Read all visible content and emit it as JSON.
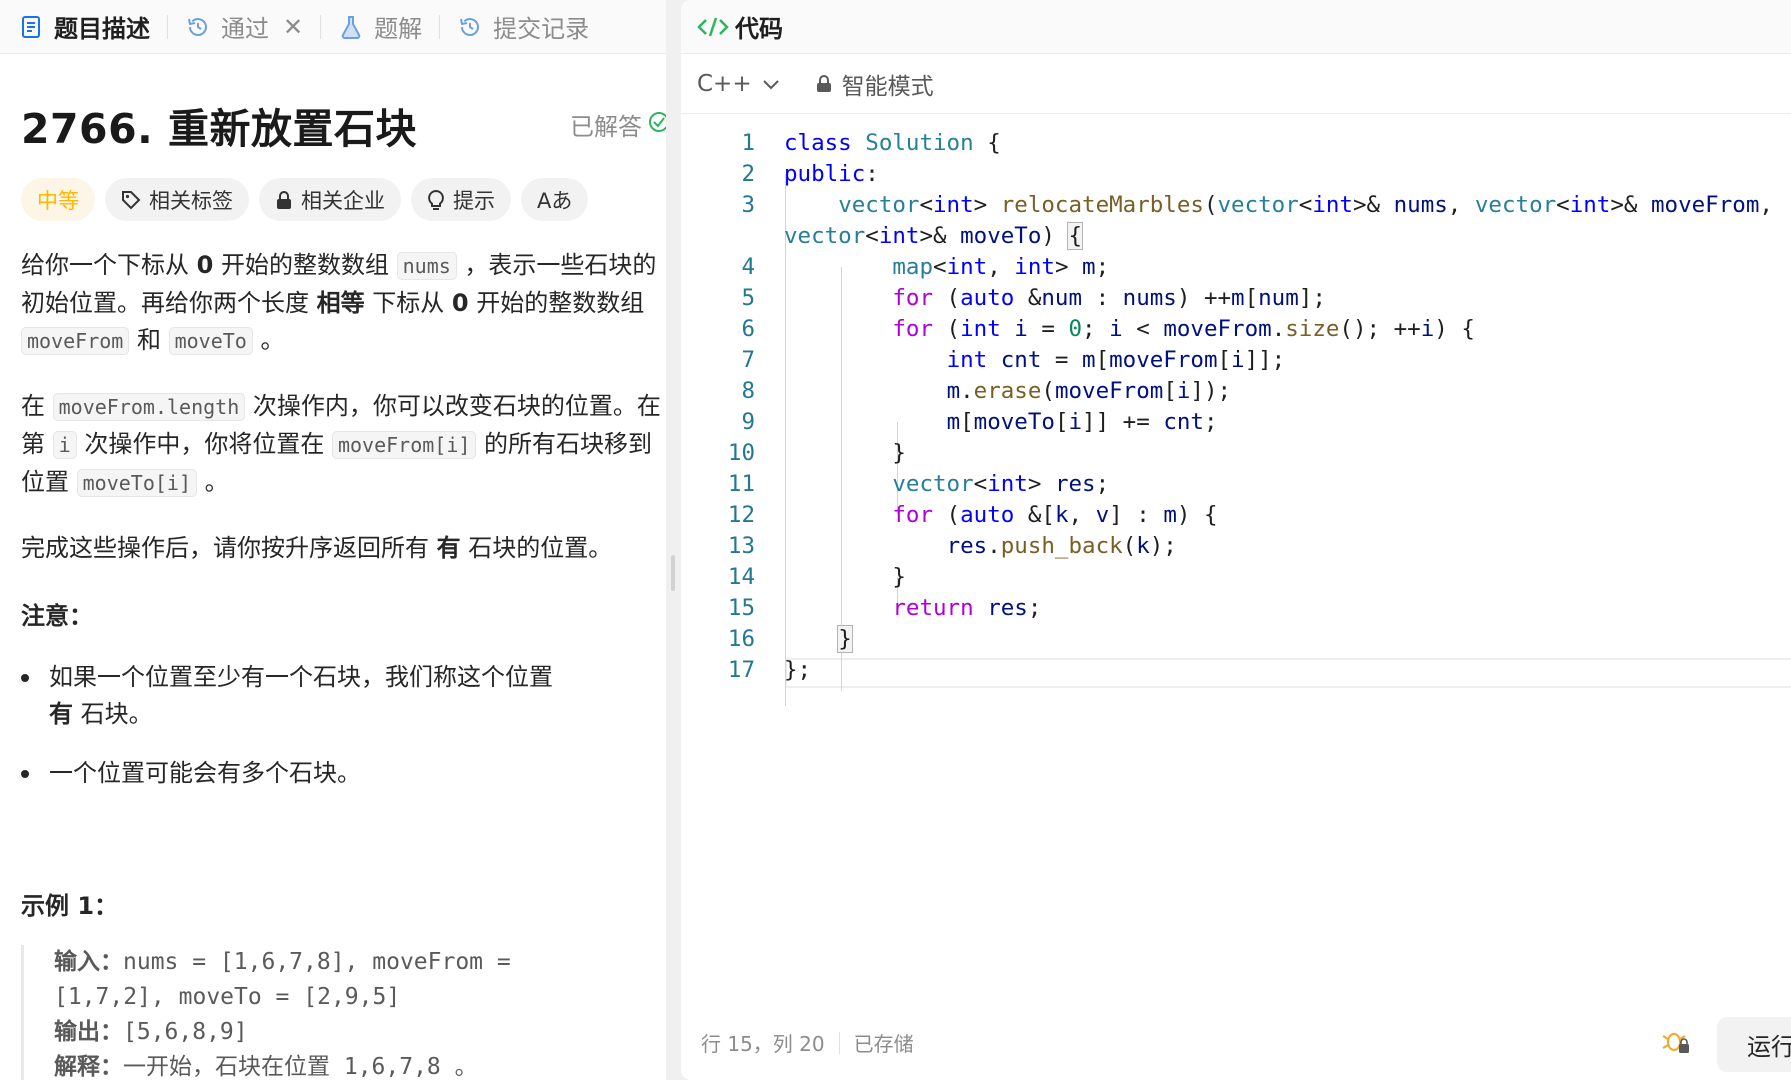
{
  "left_tabs": [
    {
      "label": "题目描述",
      "icon": "document-icon",
      "active": true
    },
    {
      "label": "通过",
      "icon": "history-icon",
      "closable": true
    },
    {
      "label": "题解",
      "icon": "flask-icon"
    },
    {
      "label": "提交记录",
      "icon": "history-icon"
    }
  ],
  "problem": {
    "title": "2766. 重新放置石块",
    "status": "已解答",
    "tags": [
      {
        "label": "中等"
      },
      {
        "label": "相关标签",
        "icon": "tag-icon"
      },
      {
        "label": "相关企业",
        "icon": "lock-icon"
      },
      {
        "label": "提示",
        "icon": "lightbulb-icon"
      },
      {
        "label": "Aあ",
        "icon": "translate-icon"
      }
    ],
    "p1": [
      "给你一个下标从 ",
      "0",
      " 开始的整数数组 ",
      "nums",
      " ，表示一些石块的初始位置。再给你两个长度 ",
      "相等",
      " 下标从 ",
      "0",
      " 开始的整数数组 ",
      "moveFrom",
      " 和 ",
      "moveTo",
      " 。"
    ],
    "p2": [
      "在 ",
      "moveFrom.length",
      " 次操作内，你可以改变石块的位置。在第 ",
      "i",
      " 次操作中，你将位置在 ",
      "moveFrom[i]",
      " 的所有石块移到位置 ",
      "moveTo[i]",
      " 。"
    ],
    "p3": [
      "完成这些操作后，请你按升序返回所有 ",
      "有",
      " 石块的位置。"
    ],
    "note_heading": "注意：",
    "bullet1": [
      "如果一个位置至少有一个石块，我们称这个位置 ",
      "有",
      " 石块。"
    ],
    "bullet2": "一个位置可能会有多个石块。",
    "example_heading": "示例 1：",
    "example": {
      "input_label": "输入：",
      "input_line1": "nums = [1,6,7,8], moveFrom =",
      "input_line2": "[1,7,2], moveTo = [2,9,5]",
      "output_label": "输出：",
      "output": "[5,6,8,9]",
      "explain_label": "解释：",
      "explain": "一开始，石块在位置 1,6,7,8 。"
    }
  },
  "code_panel": {
    "title": "代码",
    "language": "C++",
    "mode": "智能模式",
    "line_numbers": [
      "1",
      "2",
      "3",
      "",
      "4",
      "5",
      "6",
      "7",
      "8",
      "9",
      "10",
      "11",
      "12",
      "13",
      "14",
      "15",
      "16",
      "17"
    ]
  },
  "status_bar": {
    "cursor": "行 15，列 20",
    "saved": "已存储",
    "run": "运行"
  },
  "colors": {
    "accent_green": "#2db55d",
    "medium_yellow": "#ffb800",
    "keyword_blue": "#0000ff",
    "control_purple": "#af00db",
    "type_teal": "#267f99",
    "function_brown": "#795e26"
  }
}
